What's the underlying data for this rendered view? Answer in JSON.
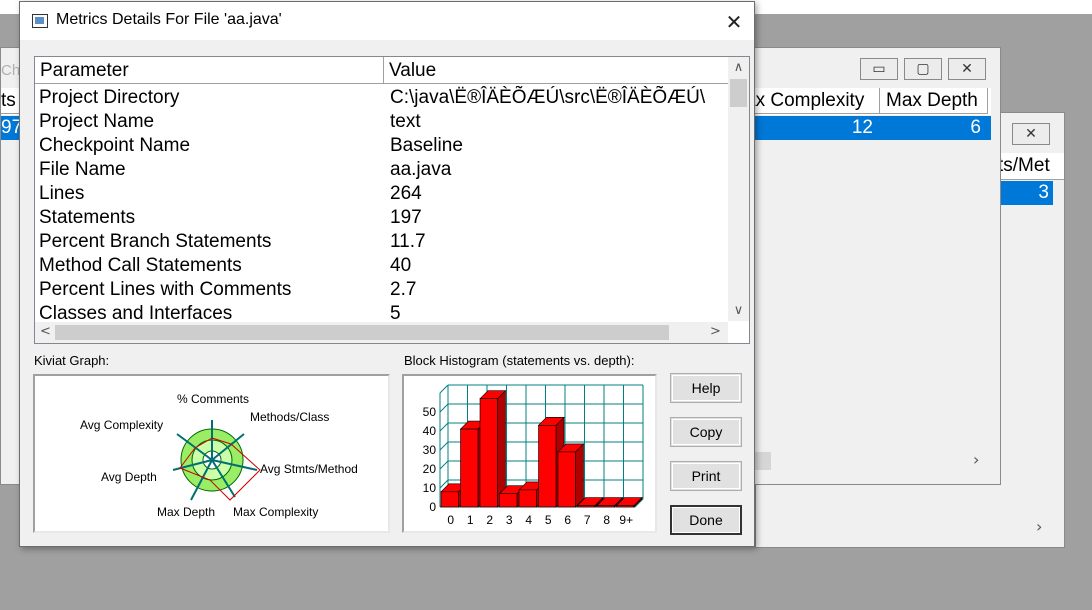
{
  "background": {
    "bg_window": {
      "title_partial": "Ch",
      "left_cell_1": "ts",
      "left_cell_2": "97",
      "col_max_complexity": "ax Complexity",
      "col_max_depth": "Max Depth",
      "row_max_complexity": "12",
      "row_max_depth": "6",
      "minimize_glyph": "▭",
      "maximize_glyph": "▢",
      "close_glyph": "✕"
    },
    "back_window": {
      "col_partial": "ts/Met",
      "row_value": "3",
      "close_glyph": "✕"
    },
    "scroll_right_glyph": "›"
  },
  "dialog": {
    "title": "Metrics Details For File 'aa.java'",
    "close_glyph": "✕",
    "grid": {
      "headers": [
        "Parameter",
        "Value"
      ],
      "rows": [
        {
          "param": "Project Directory",
          "value": "C:\\java\\Ë®ÎÄÈÕÆÚ\\src\\Ë®ÎÄÈÕÆÚ\\"
        },
        {
          "param": "Project Name",
          "value": "text"
        },
        {
          "param": "Checkpoint Name",
          "value": "Baseline"
        },
        {
          "param": "File Name",
          "value": "aa.java"
        },
        {
          "param": "Lines",
          "value": "264"
        },
        {
          "param": "Statements",
          "value": "197"
        },
        {
          "param": "Percent Branch Statements",
          "value": "11.7"
        },
        {
          "param": "Method Call Statements",
          "value": "40"
        },
        {
          "param": "Percent Lines with Comments",
          "value": "2.7"
        },
        {
          "param": "Classes and Interfaces",
          "value": "5"
        }
      ],
      "arrows": {
        "up": "∧",
        "down": "∨",
        "left": "<",
        "right": ">"
      }
    },
    "kiviat": {
      "label": "Kiviat Graph:",
      "axes": [
        "% Comments",
        "Methods/Class",
        "Avg Stmts/Method",
        "Max Complexity",
        "Max Depth",
        "Avg Depth",
        "Avg Complexity"
      ],
      "colors": {
        "outer_ring": "#99ee66",
        "inner_ring": "#ccffaa",
        "axis": "#007070",
        "polygon": "#cc0000"
      }
    },
    "histogram": {
      "label": "Block Histogram (statements vs. depth):",
      "colors": {
        "bar": "#ff0000",
        "bar_side": "#b00000",
        "grid": "#008080"
      }
    },
    "buttons": {
      "help": "Help",
      "copy": "Copy",
      "print": "Print",
      "done": "Done"
    }
  },
  "chart_data": {
    "type": "bar",
    "title": "Block Histogram (statements vs. depth):",
    "categories": [
      "0",
      "1",
      "2",
      "3",
      "4",
      "5",
      "6",
      "7",
      "8",
      "9+"
    ],
    "values": [
      8,
      41,
      57,
      7,
      9,
      43,
      29,
      0,
      0,
      0
    ],
    "yticks": [
      "0",
      "10",
      "20",
      "30",
      "40",
      "50"
    ],
    "ylim": [
      0,
      60
    ],
    "grid": true
  }
}
